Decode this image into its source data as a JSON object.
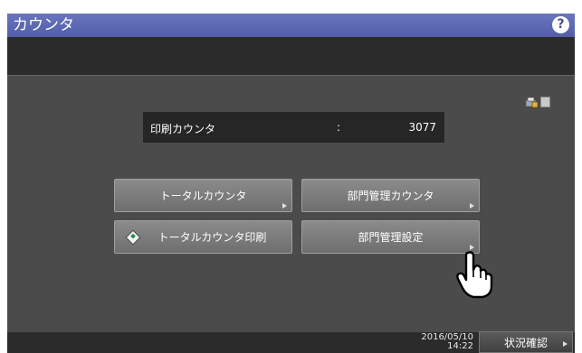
{
  "window": {
    "title": "カウンタ",
    "help_label": "?"
  },
  "counter": {
    "label": "印刷カウンタ",
    "separator": ":",
    "value": "3077"
  },
  "buttons": {
    "total_counter": "トータルカウンタ",
    "dept_counter": "部門管理カウンタ",
    "print_total": "トータルカウンタ印刷",
    "dept_settings": "部門管理設定"
  },
  "footer": {
    "date": "2016/05/10",
    "time": "14:22",
    "status_label": "状況確認"
  },
  "icons": [
    "printer-lock-icon",
    "memory-icon",
    "diamond-start-icon",
    "hand-pointer-icon"
  ],
  "colors": {
    "title_bar": "#5a65b0",
    "panel": "#4b4b4b",
    "button": "#7c7c7c"
  }
}
